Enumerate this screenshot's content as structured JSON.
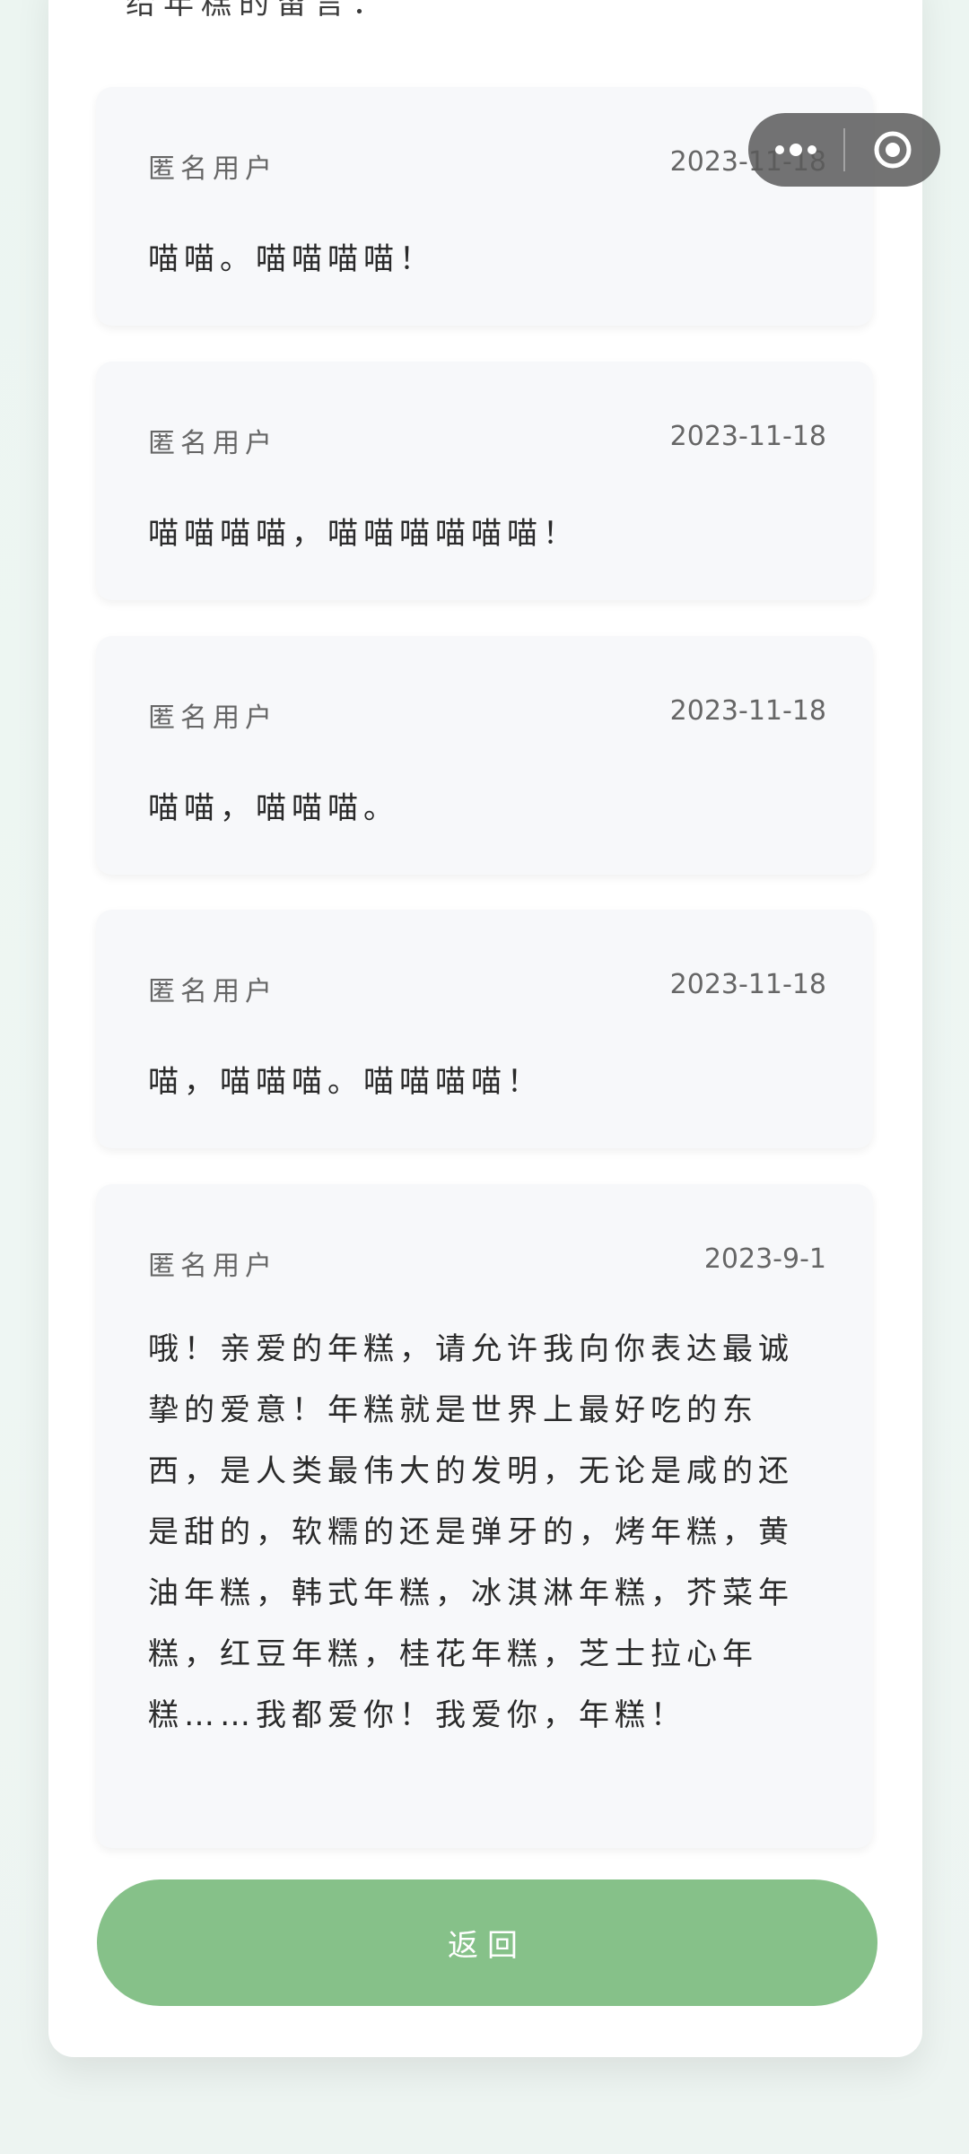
{
  "header": {
    "partial_heading": "给年糕的留言："
  },
  "comments": [
    {
      "user": "匿名用户",
      "date": "2023-11-18",
      "text": "喵喵。喵喵喵喵！"
    },
    {
      "user": "匿名用户",
      "date": "2023-11-18",
      "text": "喵喵喵喵，喵喵喵喵喵喵！"
    },
    {
      "user": "匿名用户",
      "date": "2023-11-18",
      "text": "喵喵，喵喵喵。"
    },
    {
      "user": "匿名用户",
      "date": "2023-11-18",
      "text": "喵，喵喵喵。喵喵喵喵！"
    },
    {
      "user": "匿名用户",
      "date": "2023-9-1",
      "text": "哦！亲爱的年糕，请允许我向你表达最诚挚的爱意！年糕就是世界上最好吃的东西，是人类最伟大的发明，无论是咸的还是甜的，软糯的还是弹牙的，烤年糕，黄油年糕，韩式年糕，冰淇淋年糕，芥菜年糕，红豆年糕，桂花年糕，芝士拉心年糕……我都爱你！我爱你，年糕！"
    }
  ],
  "actions": {
    "back_label": "返回"
  },
  "capsule": {
    "more_icon": "more-dots-icon",
    "close_icon": "target-circle-icon"
  },
  "colors": {
    "accent": "#86c189",
    "card_bg": "#f7f8fa",
    "page_bg": "#eef5f2"
  }
}
